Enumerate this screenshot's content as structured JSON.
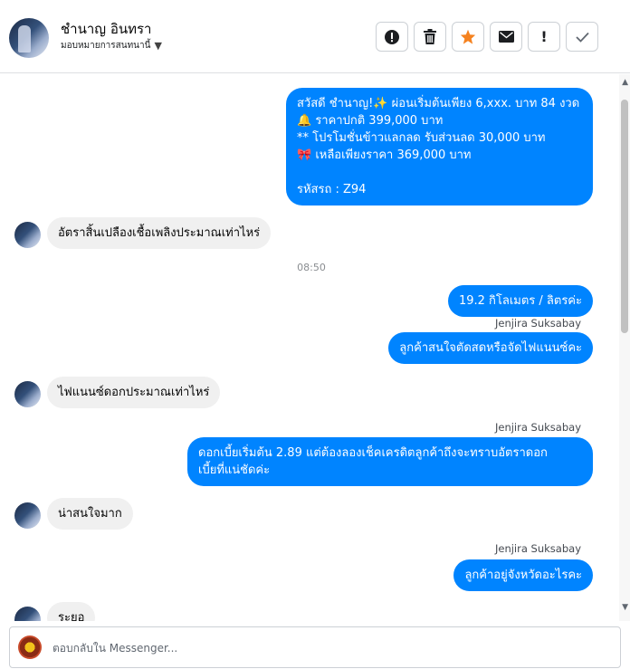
{
  "header": {
    "contact_name": "ชำนาญ อินทรา",
    "assign_label": "มอบหมายการสนทนานี้",
    "tools": [
      {
        "name": "report-spam-button",
        "icon": "alert-circle-icon",
        "glyph": "!"
      },
      {
        "name": "delete-button",
        "icon": "trash-icon",
        "glyph": "🗑"
      },
      {
        "name": "star-button",
        "icon": "star-icon",
        "glyph": "★"
      },
      {
        "name": "mark-unread-button",
        "icon": "envelope-icon",
        "glyph": "✉"
      },
      {
        "name": "follow-up-button",
        "icon": "exclamation-icon",
        "glyph": "!"
      },
      {
        "name": "mark-done-button",
        "icon": "check-icon",
        "glyph": "✓"
      }
    ]
  },
  "thread": {
    "msg1_line1": "สวัสดี ชำนาญ!✨  ผ่อนเริ่มต้นเพียง 6,xxx. บาท 84 งวด",
    "msg1_line2": "🔔 ราคาปกติ 399,000 บาท",
    "msg1_line3": "** โปรโมชั่นข้าวแลกลด รับส่วนลด 30,000 บาท",
    "msg1_line4": "🎀  เหลือเพียงราคา 369,000 บาท",
    "msg1_line5": "รหัสรถ : Z94",
    "msg2": "อัตราสิ้นเปลืองเชื้อเพลิงประมาณเท่าไหร่",
    "time1": "08:50",
    "msg3": "19.2 กิโลเมตร / ลิตรค่ะ",
    "sender": "Jenjira Suksabay",
    "msg4": "ลูกค้าสนใจตัดสดหรือจัดไฟแนนซ์คะ",
    "msg5": "ไฟแนนซ์ดอกประมาณเท่าไหร่",
    "msg6_line1": "ดอกเบี้ยเริ่มต้น 2.89 แต่ต้องลองเช็คเครดิตลูกค้าถึงจะทราบอัตราดอก",
    "msg6_line2": "เบี้ยที่แน่ชัดค่ะ",
    "msg7": "น่าสนใจมาก",
    "msg8": "ลูกค้าอยู่จังหวัดอะไรคะ",
    "msg9_partial": "ระยอ"
  },
  "composer": {
    "placeholder": "ตอบกลับใน Messenger..."
  },
  "colors": {
    "outgoing_bubble": "#0084ff",
    "incoming_bubble": "#f0f0f0",
    "star_accent": "#f5821f"
  }
}
